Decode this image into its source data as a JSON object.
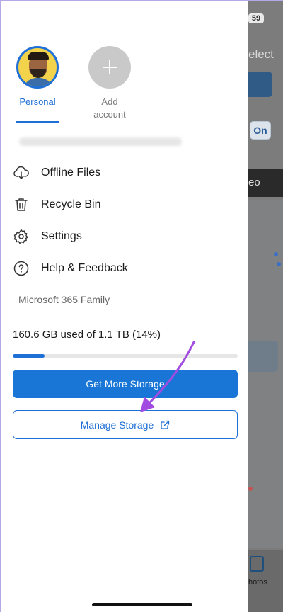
{
  "background_app": {
    "battery": "59",
    "select_text": "elect",
    "toggle_label": "On",
    "video_text": "eo",
    "tab_label": "hotos"
  },
  "accounts": [
    {
      "label": "Personal",
      "selected": true
    },
    {
      "label": "Add\naccount",
      "selected": false
    }
  ],
  "menu": [
    {
      "label": "Offline Files",
      "icon": "cloud-download-icon"
    },
    {
      "label": "Recycle Bin",
      "icon": "trash-icon"
    },
    {
      "label": "Settings",
      "icon": "gear-icon"
    },
    {
      "label": "Help & Feedback",
      "icon": "help-circle-icon"
    }
  ],
  "storage": {
    "plan": "Microsoft 365 Family",
    "usage_text": "160.6 GB used of 1.1 TB (14%)",
    "usage_fraction": 0.14,
    "get_more_label": "Get More Storage",
    "manage_label": "Manage Storage",
    "manage_icon": "external-link-icon"
  },
  "colors": {
    "accent": "#1e6fd6",
    "annotation_arrow": "#a24be0"
  }
}
